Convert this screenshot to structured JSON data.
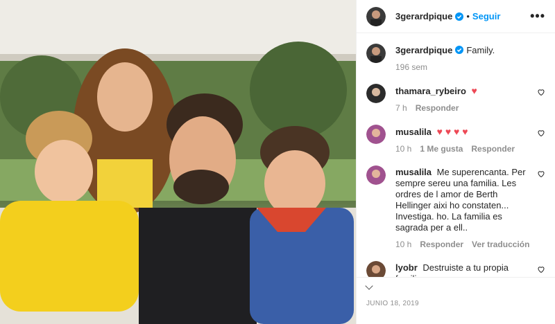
{
  "post": {
    "author": "3gerardpique",
    "follow_label": "Seguir",
    "more_label": "•••",
    "caption_user": "3gerardpique",
    "caption": "Family.",
    "caption_time": "196 sem",
    "date": "JUNIO 18, 2019"
  },
  "comments": [
    {
      "user": "thamara_rybeiro",
      "text": "♥",
      "time": "7 h",
      "likes": "",
      "reply": "Responder",
      "translate": ""
    },
    {
      "user": "musalila",
      "text": "♥ ♥ ♥ ♥",
      "time": "10 h",
      "likes": "1 Me gusta",
      "reply": "Responder",
      "translate": ""
    },
    {
      "user": "musalila",
      "text": "Me superencanta. Per sempre sereu una familia. Les ordres de l amor de Berth Hellinger aixi ho constaten... Investiga. ho. La familia es sagrada per a ell..",
      "time": "10 h",
      "likes": "",
      "reply": "Responder",
      "translate": "Ver traducción"
    },
    {
      "user": "lyobr",
      "text": "Destruiste a tu propia familia.",
      "time": "",
      "likes": "",
      "reply": "",
      "translate": ""
    }
  ],
  "colors": {
    "link": "#0095f6",
    "verified": "#0095f6",
    "heart": "#ed4956",
    "muted": "#8e8e8e"
  }
}
